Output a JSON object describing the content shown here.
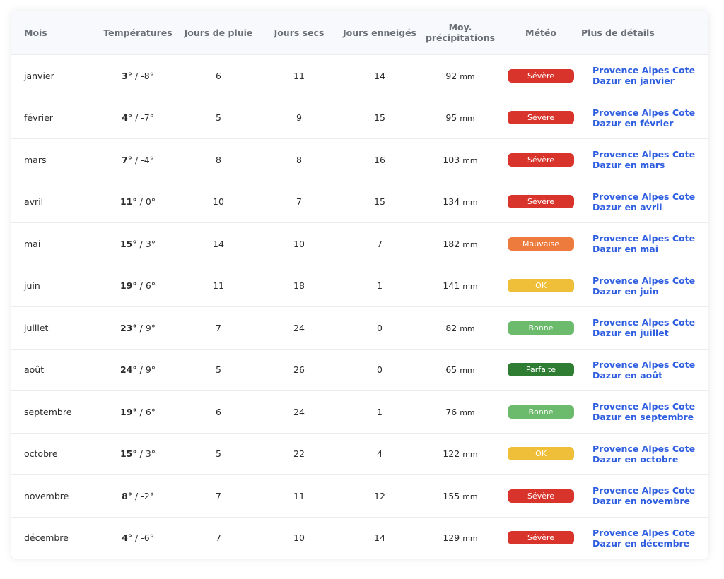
{
  "headers": {
    "mois": "Mois",
    "temperatures": "Températures",
    "jours_pluie": "Jours de pluie",
    "jours_secs": "Jours secs",
    "jours_enneiges": "Jours enneigés",
    "moy_line1": "Moy.",
    "moy_line2": "précipitations",
    "meteo": "Météo",
    "details": "Plus de détails"
  },
  "separator": "/",
  "unit_mm": "mm",
  "colors": {
    "Sévère": "#d9342b",
    "Mauvaise": "#ee7b3e",
    "OK": "#f0bf3a",
    "Bonne": "#6cbb6c",
    "Parfaite": "#2e7d32",
    "link": "#2f5fe0"
  },
  "rows": [
    {
      "mois": "janvier",
      "tmax": "3°",
      "tmin": "-8°",
      "pluie": "6",
      "secs": "11",
      "neige": "14",
      "prec": "92",
      "meteo": "Sévère",
      "link1": "Provence Alpes Cote",
      "link2": "Dazur en janvier"
    },
    {
      "mois": "février",
      "tmax": "4°",
      "tmin": "-7°",
      "pluie": "5",
      "secs": "9",
      "neige": "15",
      "prec": "95",
      "meteo": "Sévère",
      "link1": "Provence Alpes Cote",
      "link2": "Dazur en février"
    },
    {
      "mois": "mars",
      "tmax": "7°",
      "tmin": "-4°",
      "pluie": "8",
      "secs": "8",
      "neige": "16",
      "prec": "103",
      "meteo": "Sévère",
      "link1": "Provence Alpes Cote",
      "link2": "Dazur en mars"
    },
    {
      "mois": "avril",
      "tmax": "11°",
      "tmin": "0°",
      "pluie": "10",
      "secs": "7",
      "neige": "15",
      "prec": "134",
      "meteo": "Sévère",
      "link1": "Provence Alpes Cote",
      "link2": "Dazur en avril"
    },
    {
      "mois": "mai",
      "tmax": "15°",
      "tmin": "3°",
      "pluie": "14",
      "secs": "10",
      "neige": "7",
      "prec": "182",
      "meteo": "Mauvaise",
      "link1": "Provence Alpes Cote",
      "link2": "Dazur en mai"
    },
    {
      "mois": "juin",
      "tmax": "19°",
      "tmin": "6°",
      "pluie": "11",
      "secs": "18",
      "neige": "1",
      "prec": "141",
      "meteo": "OK",
      "link1": "Provence Alpes Cote",
      "link2": "Dazur en juin"
    },
    {
      "mois": "juillet",
      "tmax": "23°",
      "tmin": "9°",
      "pluie": "7",
      "secs": "24",
      "neige": "0",
      "prec": "82",
      "meteo": "Bonne",
      "link1": "Provence Alpes Cote",
      "link2": "Dazur en juillet"
    },
    {
      "mois": "août",
      "tmax": "24°",
      "tmin": "9°",
      "pluie": "5",
      "secs": "26",
      "neige": "0",
      "prec": "65",
      "meteo": "Parfaite",
      "link1": "Provence Alpes Cote",
      "link2": "Dazur en août"
    },
    {
      "mois": "septembre",
      "tmax": "19°",
      "tmin": "6°",
      "pluie": "6",
      "secs": "24",
      "neige": "1",
      "prec": "76",
      "meteo": "Bonne",
      "link1": "Provence Alpes Cote",
      "link2": "Dazur en septembre"
    },
    {
      "mois": "octobre",
      "tmax": "15°",
      "tmin": "3°",
      "pluie": "5",
      "secs": "22",
      "neige": "4",
      "prec": "122",
      "meteo": "OK",
      "link1": "Provence Alpes Cote",
      "link2": "Dazur en octobre"
    },
    {
      "mois": "novembre",
      "tmax": "8°",
      "tmin": "-2°",
      "pluie": "7",
      "secs": "11",
      "neige": "12",
      "prec": "155",
      "meteo": "Sévère",
      "link1": "Provence Alpes Cote",
      "link2": "Dazur en novembre"
    },
    {
      "mois": "décembre",
      "tmax": "4°",
      "tmin": "-6°",
      "pluie": "7",
      "secs": "10",
      "neige": "14",
      "prec": "129",
      "meteo": "Sévère",
      "link1": "Provence Alpes Cote",
      "link2": "Dazur en décembre"
    }
  ]
}
